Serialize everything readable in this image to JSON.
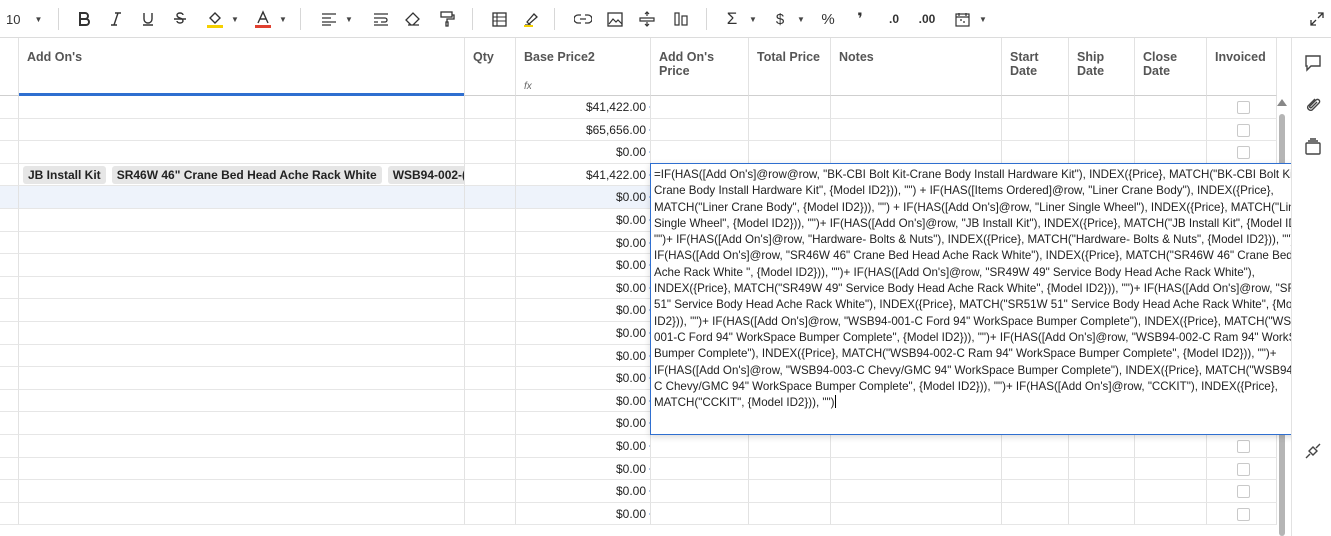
{
  "toolbar": {
    "font_size": "10",
    "items": [
      "bold-icon",
      "italic-icon",
      "underline-icon",
      "strikethrough-icon",
      "fill-color-icon",
      "text-color-icon",
      "align-icon",
      "wrap-icon",
      "clear-format-icon",
      "format-painter-icon",
      "table-icon",
      "highlight-icon",
      "link-icon",
      "image-icon",
      "row-height-icon",
      "column-width-icon",
      "sum-icon",
      "currency-icon",
      "percent-icon",
      "comma-icon",
      "decrease-decimal-icon",
      "increase-decimal-icon",
      "date-format-icon",
      "expand-icon"
    ],
    "accent_fill": "#f5d000",
    "accent_text": "#e04030",
    "sum_label": "Σ",
    "currency_label": "$",
    "percent_label": "%",
    "decimal_dec_label": ".0",
    "decimal_inc_label": ".00"
  },
  "columns": {
    "add_ons": "Add On's",
    "qty": "Qty",
    "base_price": "Base Price2",
    "base_price_fx": "fx",
    "add_ons_price": "Add On's Price",
    "total_price": "Total Price",
    "notes": "Notes",
    "start_date": "Start Date",
    "ship_date": "Ship Date",
    "close_date": "Close Date",
    "invoiced": "Invoiced"
  },
  "rows": [
    {
      "base_price": "$41,422.00",
      "chips": []
    },
    {
      "base_price": "$65,656.00",
      "chips": []
    },
    {
      "base_price": "$0.00",
      "chips": []
    },
    {
      "base_price": "$41,422.00",
      "chips": [
        "JB Install Kit",
        "SR46W 46\" Crane Bed Head Ache Rack White",
        "WSB94-002-("
      ]
    },
    {
      "base_price": "$0.00",
      "chips": []
    },
    {
      "base_price": "$0.00",
      "chips": []
    },
    {
      "base_price": "$0.00",
      "chips": []
    },
    {
      "base_price": "$0.00",
      "chips": []
    },
    {
      "base_price": "$0.00",
      "chips": []
    },
    {
      "base_price": "$0.00",
      "chips": []
    },
    {
      "base_price": "$0.00",
      "chips": []
    },
    {
      "base_price": "$0.00",
      "chips": []
    },
    {
      "base_price": "$0.00",
      "chips": []
    },
    {
      "base_price": "$0.00",
      "chips": []
    },
    {
      "base_price": "$0.00",
      "chips": []
    },
    {
      "base_price": "$0.00",
      "chips": []
    },
    {
      "base_price": "$0.00",
      "chips": []
    },
    {
      "base_price": "$0.00",
      "chips": []
    },
    {
      "base_price": "$0.00",
      "chips": []
    }
  ],
  "formula": "=IF(HAS([Add On's]@row@row, \"BK-CBI Bolt Kit-Crane Body Install Hardware Kit\"), INDEX({Price}, MATCH(\"BK-CBI Bolt Kit-Crane Body Install Hardware Kit\", {Model ID2})), \"\") + IF(HAS([Items Ordered]@row, \"Liner Crane Body\"), INDEX({Price}, MATCH(\"Liner Crane Body\", {Model ID2})), \"\") + IF(HAS([Add On's]@row, \"Liner Single Wheel\"), INDEX({Price}, MATCH(\"Liner Single Wheel\", {Model ID2})), \"\")+ IF(HAS([Add On's]@row, \"JB Install Kit\"), INDEX({Price}, MATCH(\"JB Install Kit\", {Model ID2})), \"\")+ IF(HAS([Add On's]@row, \"Hardware- Bolts & Nuts\"), INDEX({Price}, MATCH(\"Hardware- Bolts & Nuts\", {Model ID2})), \"\")+ IF(HAS([Add On's]@row, \"SR46W 46\"  Crane Bed Head Ache Rack White\"), INDEX({Price}, MATCH(\"SR46W 46\"  Crane Bed Head Ache Rack White \", {Model ID2})), \"\")+ IF(HAS([Add On's]@row, \"SR49W 49\" Service Body Head Ache Rack White\"), INDEX({Price}, MATCH(\"SR49W 49\" Service Body Head Ache Rack White\", {Model ID2})), \"\")+ IF(HAS([Add On's]@row, \"SR51W 51\" Service Body Head Ache Rack White\"), INDEX({Price}, MATCH(\"SR51W 51\" Service Body Head Ache Rack White\", {Model ID2})), \"\")+ IF(HAS([Add On's]@row, \"WSB94-001-C Ford 94\" WorkSpace Bumper Complete\"), INDEX({Price}, MATCH(\"WSB94-001-C Ford 94\" WorkSpace Bumper Complete\", {Model ID2})), \"\")+ IF(HAS([Add On's]@row, \"WSB94-002-C  Ram 94\" WorkSpace Bumper Complete\"), INDEX({Price}, MATCH(\"WSB94-002-C  Ram 94\" WorkSpace Bumper Complete\", {Model ID2})), \"\")+ IF(HAS([Add On's]@row, \"WSB94-003-C  Chevy/GMC 94\" WorkSpace Bumper Complete\"), INDEX({Price}, MATCH(\"WSB94-003-C  Chevy/GMC 94\" WorkSpace Bumper Complete\", {Model ID2})), \"\")+ IF(HAS([Add On's]@row, \"CCKIT\"), INDEX({Price}, MATCH(\"CCKIT\", {Model ID2})), \"\")",
  "rail": [
    "comment-icon",
    "attachment-icon",
    "proofing-icon",
    "connection-icon"
  ]
}
